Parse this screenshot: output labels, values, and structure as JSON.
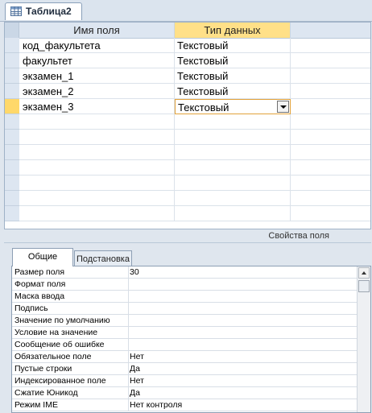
{
  "document_tab": {
    "title": "Таблица2",
    "icon": "table-icon"
  },
  "grid": {
    "columns": {
      "name": "Имя поля",
      "type": "Тип данных"
    },
    "rows": [
      {
        "name": "код_факультета",
        "type": "Текстовый"
      },
      {
        "name": "факультет",
        "type": "Текстовый"
      },
      {
        "name": "экзамен_1",
        "type": "Текстовый"
      },
      {
        "name": "экзамен_2",
        "type": "Текстовый"
      },
      {
        "name": "экзамен_3",
        "type": "Текстовый"
      }
    ]
  },
  "properties": {
    "title": "Свойства поля",
    "tabs": {
      "general": "Общие",
      "lookup": "Подстановка"
    },
    "items": [
      {
        "name": "Размер поля",
        "value": "30"
      },
      {
        "name": "Формат поля",
        "value": ""
      },
      {
        "name": "Маска ввода",
        "value": ""
      },
      {
        "name": "Подпись",
        "value": ""
      },
      {
        "name": "Значение по умолчанию",
        "value": ""
      },
      {
        "name": "Условие на значение",
        "value": ""
      },
      {
        "name": "Сообщение об ошибке",
        "value": ""
      },
      {
        "name": "Обязательное поле",
        "value": "Нет"
      },
      {
        "name": "Пустые строки",
        "value": "Да"
      },
      {
        "name": "Индексированное поле",
        "value": "Нет"
      },
      {
        "name": "Сжатие Юникод",
        "value": "Да"
      },
      {
        "name": "Режим IME",
        "value": "Нет контроля"
      }
    ]
  },
  "colors": {
    "header_highlight": "#ffe088",
    "current_row": "#ffd86a",
    "active_border": "#e2a23b"
  }
}
